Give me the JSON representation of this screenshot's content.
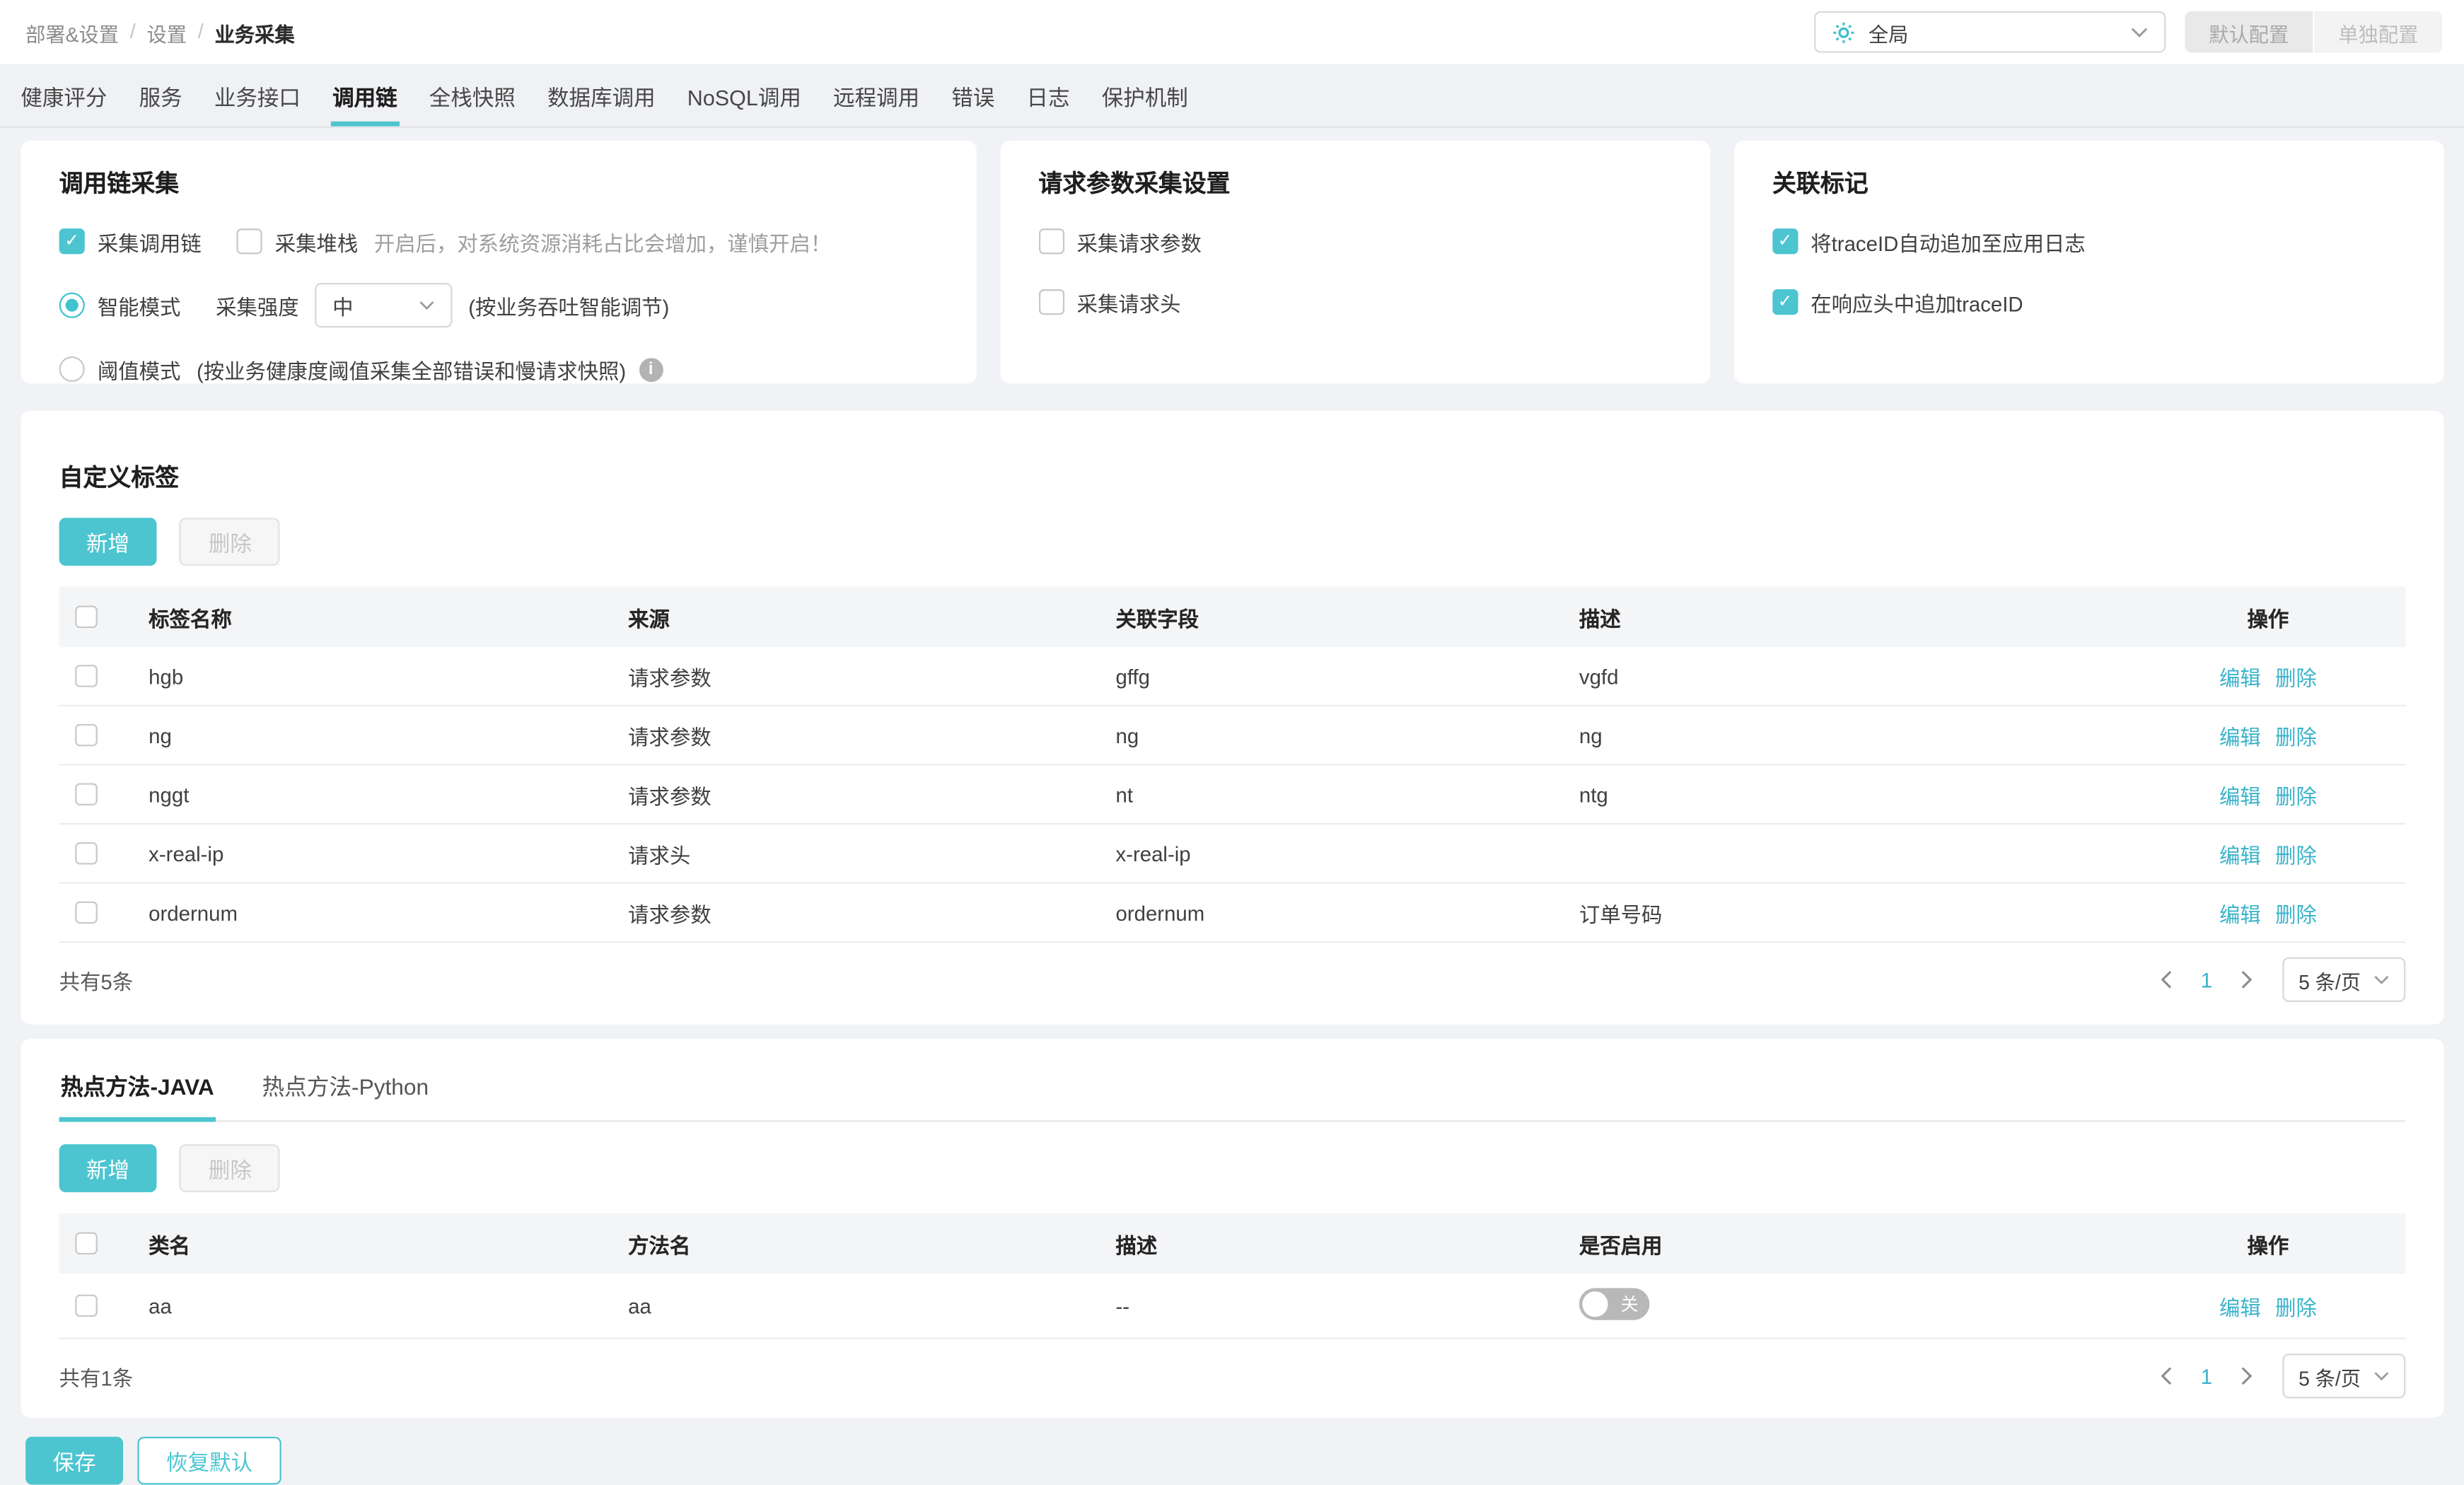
{
  "breadcrumb": {
    "items": [
      "部署&设置",
      "设置",
      "业务采集"
    ],
    "separator": "/"
  },
  "header": {
    "scope_selector": {
      "value": "全局",
      "icon": "gear"
    },
    "config_buttons": [
      {
        "label": "默认配置"
      },
      {
        "label": "单独配置"
      }
    ]
  },
  "tabs": {
    "items": [
      "健康评分",
      "服务",
      "业务接口",
      "调用链",
      "全栈快照",
      "数据库调用",
      "NoSQL调用",
      "远程调用",
      "错误",
      "日志",
      "保护机制"
    ],
    "active": "调用链"
  },
  "trace_collection_card": {
    "title": "调用链采集",
    "collect_trace": {
      "label": "采集调用链",
      "checked": true
    },
    "collect_stack": {
      "label": "采集堆栈",
      "checked": false,
      "hint": "开启后，对系统资源消耗占比会增加，谨慎开启！"
    },
    "smart_mode": {
      "label": "智能模式",
      "selected": true,
      "strength_label": "采集强度",
      "strength_value": "中",
      "note": "(按业务吞吐智能调节)"
    },
    "threshold_mode": {
      "label": "阈值模式",
      "selected": false,
      "note": "(按业务健康度阈值采集全部错误和慢请求快照)"
    }
  },
  "request_params_card": {
    "title": "请求参数采集设置",
    "options": [
      {
        "label": "采集请求参数",
        "checked": false
      },
      {
        "label": "采集请求头",
        "checked": false
      }
    ]
  },
  "trace_mark_card": {
    "title": "关联标记",
    "options": [
      {
        "label": "将traceID自动追加至应用日志",
        "checked": true
      },
      {
        "label": "在响应头中追加traceID",
        "checked": true
      }
    ]
  },
  "custom_tags": {
    "title": "自定义标签",
    "add_button": "新增",
    "delete_button": "删除",
    "columns": [
      "标签名称",
      "来源",
      "关联字段",
      "描述",
      "操作"
    ],
    "rows": [
      {
        "name": "hgb",
        "source": "请求参数",
        "field": "gffg",
        "desc": "vgfd"
      },
      {
        "name": "ng",
        "source": "请求参数",
        "field": "ng",
        "desc": "ng"
      },
      {
        "name": "nggt",
        "source": "请求参数",
        "field": "nt",
        "desc": "ntg"
      },
      {
        "name": "x-real-ip",
        "source": "请求头",
        "field": "x-real-ip",
        "desc": ""
      },
      {
        "name": "ordernum",
        "source": "请求参数",
        "field": "ordernum",
        "desc": "订单号码"
      }
    ],
    "row_actions": {
      "edit": "编辑",
      "delete": "删除"
    },
    "pagination": {
      "total": "共有5条",
      "page": "1",
      "page_size": "5 条/页"
    }
  },
  "hot_methods": {
    "tabs": [
      {
        "label": "热点方法-JAVA",
        "active": true
      },
      {
        "label": "热点方法-Python",
        "active": false
      }
    ],
    "add_button": "新增",
    "delete_button": "删除",
    "columns": [
      "类名",
      "方法名",
      "描述",
      "是否启用",
      "操作"
    ],
    "rows": [
      {
        "class_name": "aa",
        "method_name": "aa",
        "desc": "--",
        "enabled": false,
        "toggle_label": "关"
      }
    ],
    "row_actions": {
      "edit": "编辑",
      "delete": "删除"
    },
    "pagination": {
      "total": "共有1条",
      "page": "1",
      "page_size": "5 条/页"
    }
  },
  "footer": {
    "save": "保存",
    "restore": "恢复默认"
  },
  "colors": {
    "primary": "#4cc5d0",
    "link": "#39b3cb",
    "page_bg": "#f0f2f5"
  }
}
